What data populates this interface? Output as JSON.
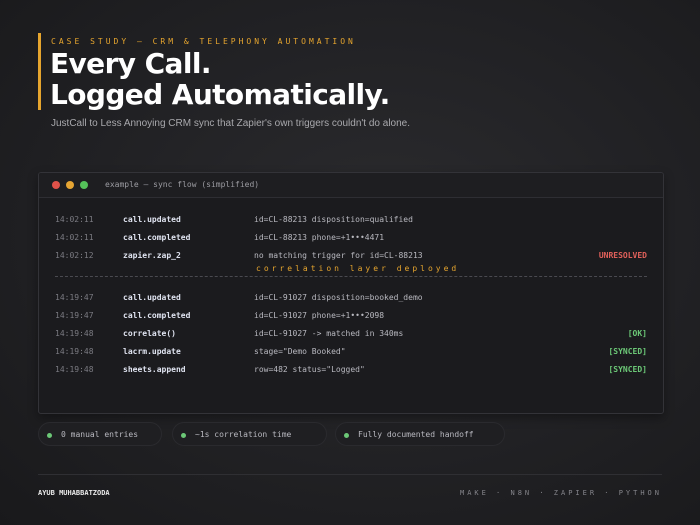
{
  "header": {
    "eyebrow": "CASE STUDY — CRM & TELEPHONY AUTOMATION",
    "headline_line1": "Every Call.",
    "headline_line2": "Logged Automatically.",
    "subtitle": "JustCall to Less Annoying CRM sync that Zapier's own triggers couldn't do alone."
  },
  "window": {
    "title": "example — sync flow (simplified)",
    "correlation_label": "correlation layer deployed",
    "log_before": [
      {
        "time": "14:02:11",
        "event": "call.updated",
        "detail": "id=CL-88213  disposition=qualified",
        "status": ""
      },
      {
        "time": "14:02:11",
        "event": "call.completed",
        "detail": "id=CL-88213  phone=+1•••4471",
        "status": ""
      },
      {
        "time": "14:02:12",
        "event": "zapier.zap_2",
        "detail": "no matching trigger for id=CL-88213",
        "status": "UNRESOLVED"
      }
    ],
    "log_after": [
      {
        "time": "14:19:47",
        "event": "call.updated",
        "detail": "id=CL-91027  disposition=booked_demo",
        "status": ""
      },
      {
        "time": "14:19:47",
        "event": "call.completed",
        "detail": "id=CL-91027  phone=+1•••2098",
        "status": ""
      },
      {
        "time": "14:19:48",
        "event": "correlate()",
        "detail": "id=CL-91027 -> matched in 340ms",
        "status": "[OK]"
      },
      {
        "time": "14:19:48",
        "event": "lacrm.update",
        "detail": "stage=\"Demo Booked\"",
        "status": "[SYNCED]"
      },
      {
        "time": "14:19:48",
        "event": "sheets.append",
        "detail": "row=482  status=\"Logged\"",
        "status": "[SYNCED]"
      }
    ]
  },
  "stats": [
    {
      "label": "0 manual entries"
    },
    {
      "label": "~1s correlation time"
    },
    {
      "label": "Fully documented handoff"
    }
  ],
  "footer": {
    "author": "AYUB MUHABBATZODA",
    "stack": "MAKE · N8N · ZAPIER · PYTHON"
  },
  "colors": {
    "accent": "#e6a52e",
    "error": "#e0605a",
    "success": "#6cc877",
    "background": "#222225"
  }
}
